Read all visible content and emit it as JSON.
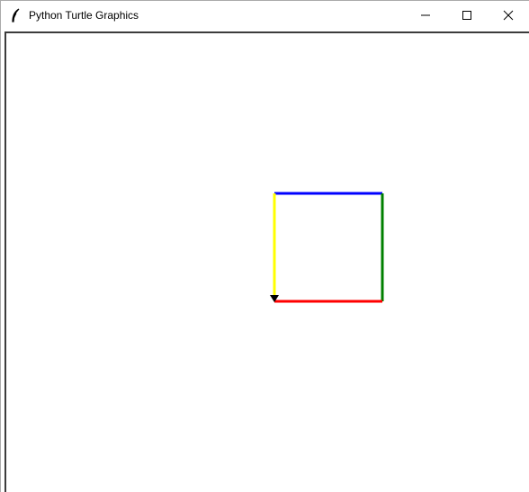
{
  "window": {
    "title": "Python Turtle Graphics",
    "app_icon": "feather-icon",
    "controls": [
      "minimize-icon",
      "maximize-icon",
      "close-icon"
    ]
  },
  "canvas": {
    "background": "#ffffff",
    "drawing": {
      "shape": "square",
      "edges": [
        {
          "name": "top",
          "color": "#0000ff"
        },
        {
          "name": "right",
          "color": "#008000"
        },
        {
          "name": "bottom",
          "color": "#ff0000"
        },
        {
          "name": "left",
          "color": "#ffff00"
        }
      ],
      "turtle": {
        "shape": "arrow",
        "heading": "down",
        "color": "#000000"
      }
    }
  }
}
